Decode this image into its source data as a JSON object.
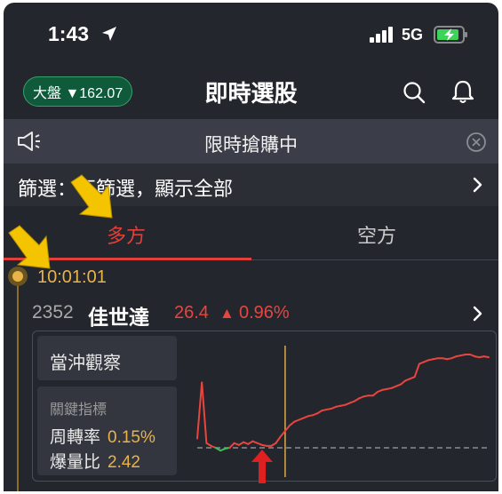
{
  "status": {
    "time": "1:43",
    "network": "5G"
  },
  "header": {
    "market_badge": "大盤 ▼162.07",
    "title": "即時選股"
  },
  "promo": {
    "text": "限時搶購中"
  },
  "filter": {
    "text": "篩選：不篩選，顯示全部"
  },
  "tabs": {
    "long": "多方",
    "short": "空方"
  },
  "event": {
    "time": "10:01:01",
    "code": "2352",
    "name": "佳世達",
    "price": "26.4",
    "change": "0.96%",
    "watch_label": "當沖觀察",
    "metrics_title": "關鍵指標",
    "metrics": [
      {
        "label": "周轉率",
        "value": "0.15%"
      },
      {
        "label": "爆量比",
        "value": "2.42"
      }
    ]
  },
  "colors": {
    "up": "#e8453e",
    "down": "#3cbf5a",
    "accent": "#e8b44a",
    "annotation_arrow": "#f5c400",
    "annotation_red": "#e02020"
  },
  "chart_data": {
    "type": "line",
    "series": [
      {
        "values": [
          0.1,
          0.7,
          0.05,
          0.02,
          0.0,
          -0.03,
          -0.01,
          0.0,
          0.05,
          0.03,
          0.06,
          0.04,
          0.07,
          0.05,
          0.03,
          0.02,
          0.02,
          0.05,
          0.12,
          0.18,
          0.24,
          0.28,
          0.3,
          0.32,
          0.34,
          0.35,
          0.37,
          0.4,
          0.41,
          0.42,
          0.44,
          0.45,
          0.46,
          0.48,
          0.5,
          0.53,
          0.55,
          0.56,
          0.56,
          0.6,
          0.62,
          0.63,
          0.64,
          0.66,
          0.68,
          0.72,
          0.74,
          0.76,
          0.9,
          0.92,
          0.94,
          0.95,
          0.96,
          0.96,
          0.95,
          0.96,
          0.98,
          0.99,
          1.0,
          1.0,
          0.98,
          0.97,
          0.98,
          0.97
        ]
      }
    ],
    "baseline": 0,
    "marker_index": 19
  }
}
